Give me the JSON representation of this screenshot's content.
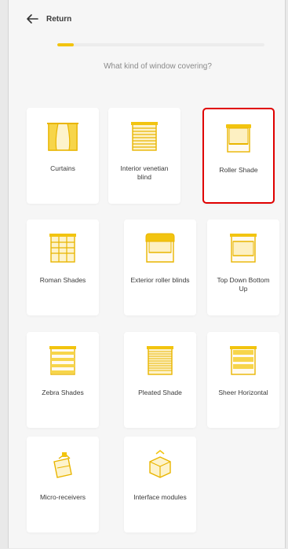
{
  "header": {
    "back_label": "Return"
  },
  "progress": {
    "value": 0.08
  },
  "question": "What kind of window covering?",
  "colors": {
    "accent": "#f2c40f",
    "selected_border": "#e00000"
  },
  "options": [
    {
      "label": "Curtains",
      "icon": "curtains-icon",
      "selected": false
    },
    {
      "label": "Interior venetian blind",
      "icon": "venetian-blind-icon",
      "selected": false
    },
    {
      "label": "Roller Shade",
      "icon": "roller-shade-icon",
      "selected": true
    },
    {
      "label": "Roman Shades",
      "icon": "roman-shade-icon",
      "selected": false
    },
    {
      "label": "Exterior roller blinds",
      "icon": "exterior-roller-blind-icon",
      "selected": false
    },
    {
      "label": "Top Down Bottom Up",
      "icon": "top-down-bottom-up-icon",
      "selected": false
    },
    {
      "label": "Zebra Shades",
      "icon": "zebra-shade-icon",
      "selected": false
    },
    {
      "label": "Pleated Shade",
      "icon": "pleated-shade-icon",
      "selected": false
    },
    {
      "label": "Sheer Horizontal",
      "icon": "sheer-horizontal-icon",
      "selected": false
    },
    {
      "label": "Micro-receivers",
      "icon": "micro-receiver-icon",
      "selected": false
    },
    {
      "label": "Interface modules",
      "icon": "interface-module-icon",
      "selected": false
    }
  ]
}
